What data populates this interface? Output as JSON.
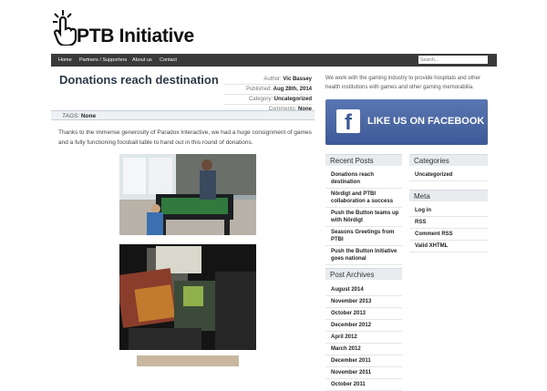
{
  "site": {
    "title": "PTB Initiative"
  },
  "nav": {
    "items": [
      "Home",
      "Partners / Supporters",
      "About us",
      "Contact"
    ],
    "search_placeholder": "Search..."
  },
  "post": {
    "title": "Donations reach destination",
    "meta": [
      {
        "label": "Author:",
        "value": "Vic Bassey"
      },
      {
        "label": "Published:",
        "value": "Aug 28th, 2014"
      },
      {
        "label": "Category:",
        "value": "Uncategorized"
      },
      {
        "label": "Comments:",
        "value": "None"
      }
    ],
    "tags_label": "TAGS:",
    "tags_value": "None",
    "body": "Thanks to the immense generosity of Paradox Interactive, we had a huge consignment of games and a fully functioning foosball table to hand out in this round of donations."
  },
  "sidebar": {
    "intro": "We work with the gaming industry to provide hospitals and other health institutions with games and other gaming memorabilia.",
    "facebook_label": "LIKE US ON FACEBOOK",
    "recent_posts": {
      "title": "Recent Posts",
      "items": [
        "Donations reach destination",
        "Nördigt and PTBI collaboration a success",
        "Push the Button teams up with Nördigt",
        "Seasons Greetings from PTBI",
        "Push the Button Initiative goes national"
      ]
    },
    "archives": {
      "title": "Post Archives",
      "items": [
        "August 2014",
        "November 2013",
        "October 2013",
        "December 2012",
        "April 2012",
        "March 2012",
        "December 2011",
        "November 2011",
        "October 2011"
      ]
    },
    "categories": {
      "title": "Categories",
      "items": [
        "Uncategorized"
      ]
    },
    "meta": {
      "title": "Meta",
      "items": [
        "Log in",
        "RSS",
        "Comment RSS",
        "Valid XHTML"
      ]
    }
  },
  "colors": {
    "nav_bg": "#3a3a3a",
    "facebook": "#3d5a98",
    "title": "#2b3a4a"
  }
}
